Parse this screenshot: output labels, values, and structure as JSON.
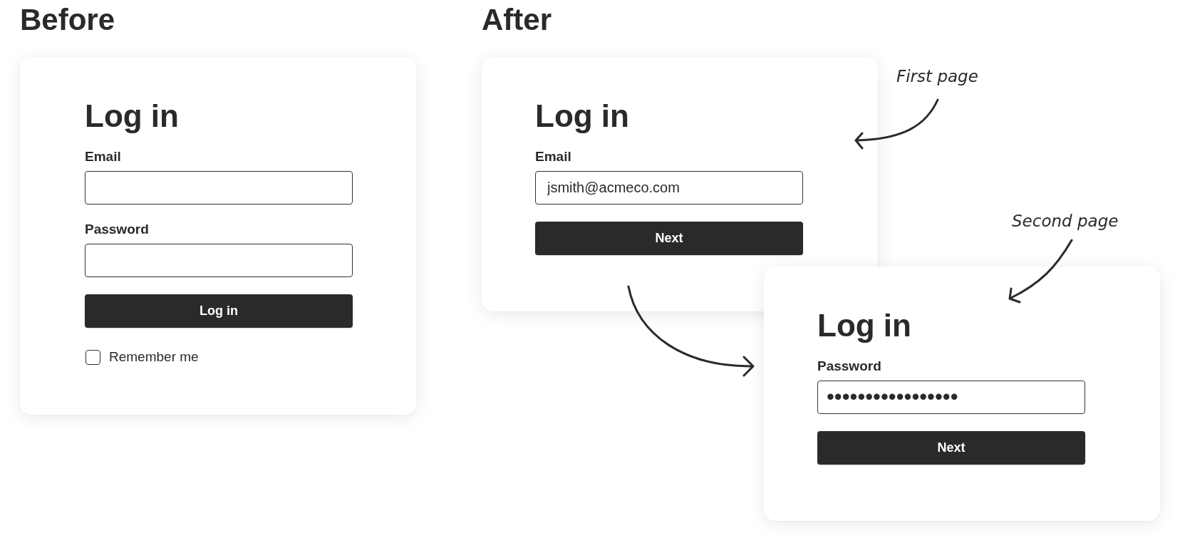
{
  "before": {
    "heading": "Before",
    "card": {
      "title": "Log in",
      "items": [
        {
          "kind": "field",
          "label": "Email"
        },
        {
          "kind": "field",
          "label": "Password"
        },
        {
          "kind": "button",
          "label": "Log in"
        },
        {
          "kind": "checkbox",
          "label": "Remember me",
          "checked": false
        }
      ]
    }
  },
  "after": {
    "heading": "After",
    "cards": [
      {
        "title": "Log in",
        "items": [
          {
            "kind": "field",
            "label": "Email",
            "value": "jsmith@acmeco.com"
          },
          {
            "kind": "button",
            "label": "Next"
          }
        ]
      },
      {
        "title": "Log in",
        "items": [
          {
            "kind": "field",
            "label": "Password",
            "value": "•••••••••••••••••",
            "masked": true
          },
          {
            "kind": "button",
            "label": "Next"
          }
        ]
      }
    ],
    "annotations": [
      "First page",
      "Second page"
    ]
  }
}
